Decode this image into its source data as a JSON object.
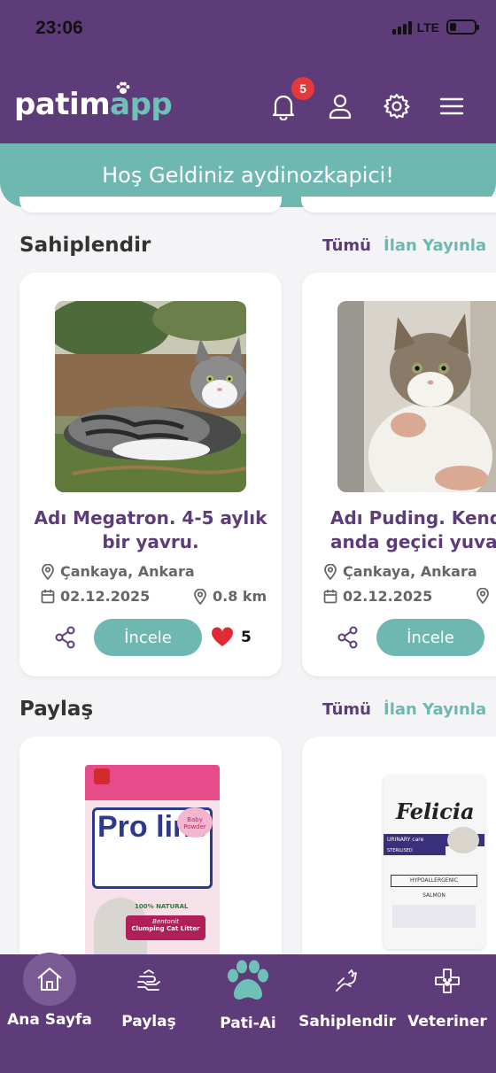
{
  "status": {
    "time": "23:06",
    "network": "LTE"
  },
  "header": {
    "logo_part1": "patim",
    "logo_part2": "app",
    "notification_count": "5"
  },
  "welcome": "Hoş Geldiniz aydinozkapici!",
  "adopt_section": {
    "title": "Sahiplendir",
    "all_link": "Tümü",
    "publish_link": "İlan Yayınla",
    "cards": [
      {
        "title": "Adı Megatron. 4-5 aylık\nbir yavru.",
        "location": "Çankaya, Ankara",
        "date": "02.12.2025",
        "distance": "0.8 km",
        "button": "İncele",
        "likes": "5"
      },
      {
        "title": "Adı Puding. Kendis\nanda geçici yuva",
        "location": "Çankaya, Ankara",
        "date": "02.12.2025",
        "button": "İncele"
      }
    ]
  },
  "share_section": {
    "title": "Paylaş",
    "all_link": "Tümü",
    "publish_link": "İlan Yayınla",
    "products": [
      {
        "brand": "Pro line",
        "subtitle": "Bentonit",
        "name": "Clumping Cat Litter",
        "badge": "Baby Powder",
        "natural": "100% NATURAL"
      },
      {
        "brand": "Felicia",
        "tag": "URINARY care",
        "sterilised": "STERILISED",
        "label": "HYPOALLERGENIC",
        "flavor": "SALMON"
      }
    ]
  },
  "bottom_nav": [
    {
      "label": "Ana Sayfa",
      "icon": "home-icon",
      "active": true
    },
    {
      "label": "Paylaş",
      "icon": "share-hands-icon"
    },
    {
      "label": "Pati-Ai",
      "icon": "paw-icon"
    },
    {
      "label": "Sahiplendir",
      "icon": "adopt-pet-icon"
    },
    {
      "label": "Veteriner",
      "icon": "vet-cross-icon"
    }
  ],
  "colors": {
    "brand_purple": "#5e3c79",
    "brand_teal": "#6fb8b1",
    "badge_red": "#e5383b",
    "heart_red": "#e02b35"
  }
}
